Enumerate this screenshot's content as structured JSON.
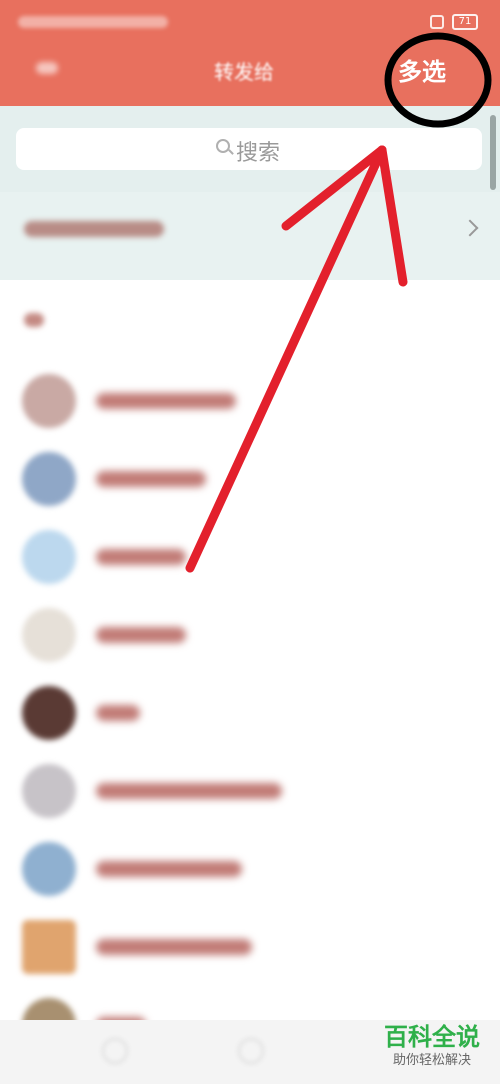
{
  "header": {
    "title": "转发给",
    "multi_select_label": "多选",
    "battery_level": "71"
  },
  "search": {
    "placeholder": "搜索"
  },
  "watermark": {
    "title": "百科全说",
    "subtitle": "助你轻松解决"
  },
  "colors": {
    "header_bg": "#e8705e",
    "search_area_bg": "#e4efee",
    "annotation_arrow": "#e3202c",
    "annotation_circle": "#000000",
    "watermark_green": "#2fb04a"
  },
  "icons": [
    "lock-icon",
    "battery-icon",
    "search-icon",
    "chevron-right-icon"
  ]
}
